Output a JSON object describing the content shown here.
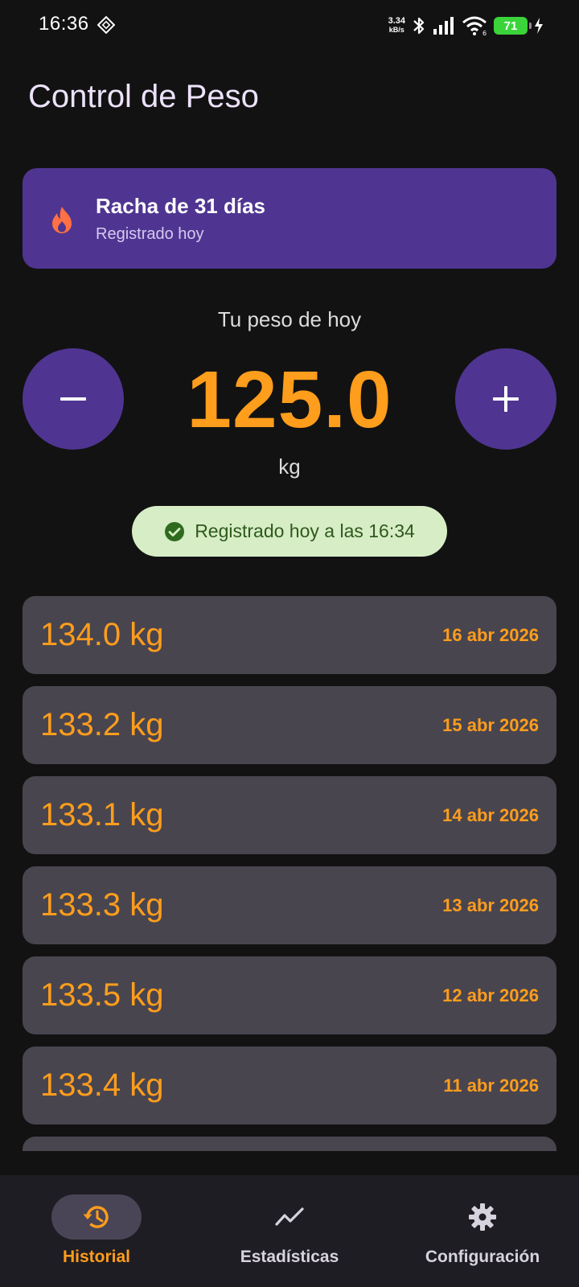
{
  "status_bar": {
    "time": "16:36",
    "net_speed": "3.34",
    "net_unit": "kB/s",
    "battery": "71",
    "signal_sim": "6"
  },
  "app": {
    "title": "Control de Peso"
  },
  "streak": {
    "title": "Racha de 31 días",
    "subtitle": "Registrado hoy",
    "icon": "fire-icon"
  },
  "weight": {
    "label": "Tu peso de hoy",
    "value": "125.0",
    "unit": "kg",
    "registered": "Registrado hoy a las 16:34"
  },
  "history": [
    {
      "weight": "134.0 kg",
      "date": "16 abr 2026"
    },
    {
      "weight": "133.2 kg",
      "date": "15 abr 2026"
    },
    {
      "weight": "133.1 kg",
      "date": "14 abr 2026"
    },
    {
      "weight": "133.3 kg",
      "date": "13 abr 2026"
    },
    {
      "weight": "133.5 kg",
      "date": "12 abr 2026"
    },
    {
      "weight": "133.4 kg",
      "date": "11 abr 2026"
    }
  ],
  "nav": {
    "items": [
      {
        "label": "Historial",
        "icon": "history-icon",
        "active": true
      },
      {
        "label": "Estadísticas",
        "icon": "trending-icon",
        "active": false
      },
      {
        "label": "Configuración",
        "icon": "gear-icon",
        "active": false
      }
    ]
  },
  "colors": {
    "background": "#121212",
    "primary_purple": "#4f3591",
    "accent_orange": "#ff9d1c",
    "row_bg": "#48454f",
    "success_bg": "#d7edc6",
    "success_fg": "#2e5a1c"
  }
}
